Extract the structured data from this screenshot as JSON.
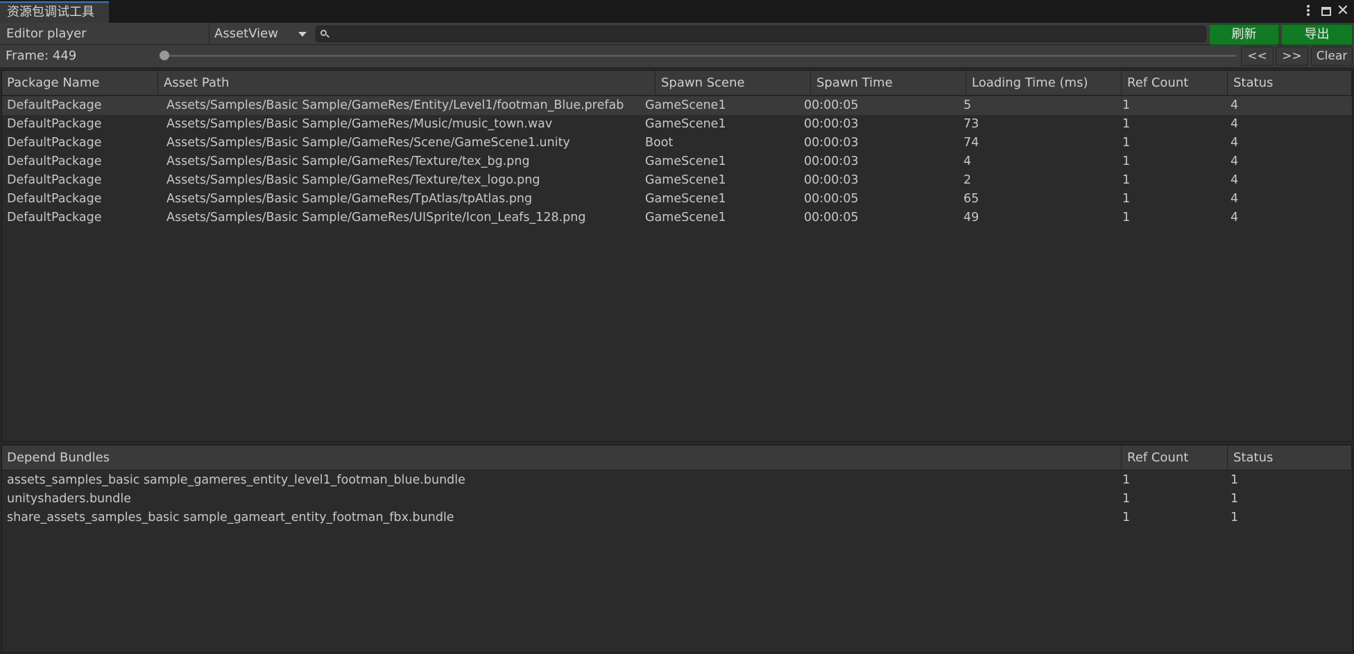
{
  "window": {
    "tab_title": "资源包调试工具"
  },
  "toolbar": {
    "mode_label": "Editor player",
    "view_dropdown": "AssetView",
    "search_value": "",
    "refresh_label": "刷新",
    "export_label": "导出"
  },
  "frame_bar": {
    "frame_label": "Frame: 449",
    "prev_label": "<<",
    "next_label": ">>",
    "clear_label": "Clear"
  },
  "asset_table": {
    "columns": [
      "Package Name",
      "Asset Path",
      "Spawn Scene",
      "Spawn Time",
      "Loading Time (ms)",
      "Ref Count",
      "Status"
    ],
    "rows": [
      [
        "DefaultPackage",
        "Assets/Samples/Basic Sample/GameRes/Entity/Level1/footman_Blue.prefab",
        "GameScene1",
        "00:00:05",
        "5",
        "1",
        "4"
      ],
      [
        "DefaultPackage",
        "Assets/Samples/Basic Sample/GameRes/Music/music_town.wav",
        "GameScene1",
        "00:00:03",
        "73",
        "1",
        "4"
      ],
      [
        "DefaultPackage",
        "Assets/Samples/Basic Sample/GameRes/Scene/GameScene1.unity",
        "Boot",
        "00:00:03",
        "74",
        "1",
        "4"
      ],
      [
        "DefaultPackage",
        "Assets/Samples/Basic Sample/GameRes/Texture/tex_bg.png",
        "GameScene1",
        "00:00:03",
        "4",
        "1",
        "4"
      ],
      [
        "DefaultPackage",
        "Assets/Samples/Basic Sample/GameRes/Texture/tex_logo.png",
        "GameScene1",
        "00:00:03",
        "2",
        "1",
        "4"
      ],
      [
        "DefaultPackage",
        "Assets/Samples/Basic Sample/GameRes/TpAtlas/tpAtlas.png",
        "GameScene1",
        "00:00:05",
        "65",
        "1",
        "4"
      ],
      [
        "DefaultPackage",
        "Assets/Samples/Basic Sample/GameRes/UISprite/Icon_Leafs_128.png",
        "GameScene1",
        "00:00:05",
        "49",
        "1",
        "4"
      ]
    ]
  },
  "bundle_table": {
    "columns": [
      "Depend Bundles",
      "Ref Count",
      "Status"
    ],
    "rows": [
      [
        "assets_samples_basic sample_gameres_entity_level1_footman_blue.bundle",
        "1",
        "1"
      ],
      [
        "unityshaders.bundle",
        "1",
        "1"
      ],
      [
        "share_assets_samples_basic sample_gameart_entity_footman_fbx.bundle",
        "1",
        "1"
      ]
    ]
  },
  "colors": {
    "accent_green": "#127a24",
    "tab_accent": "#3a79bb",
    "background": "#282828"
  }
}
